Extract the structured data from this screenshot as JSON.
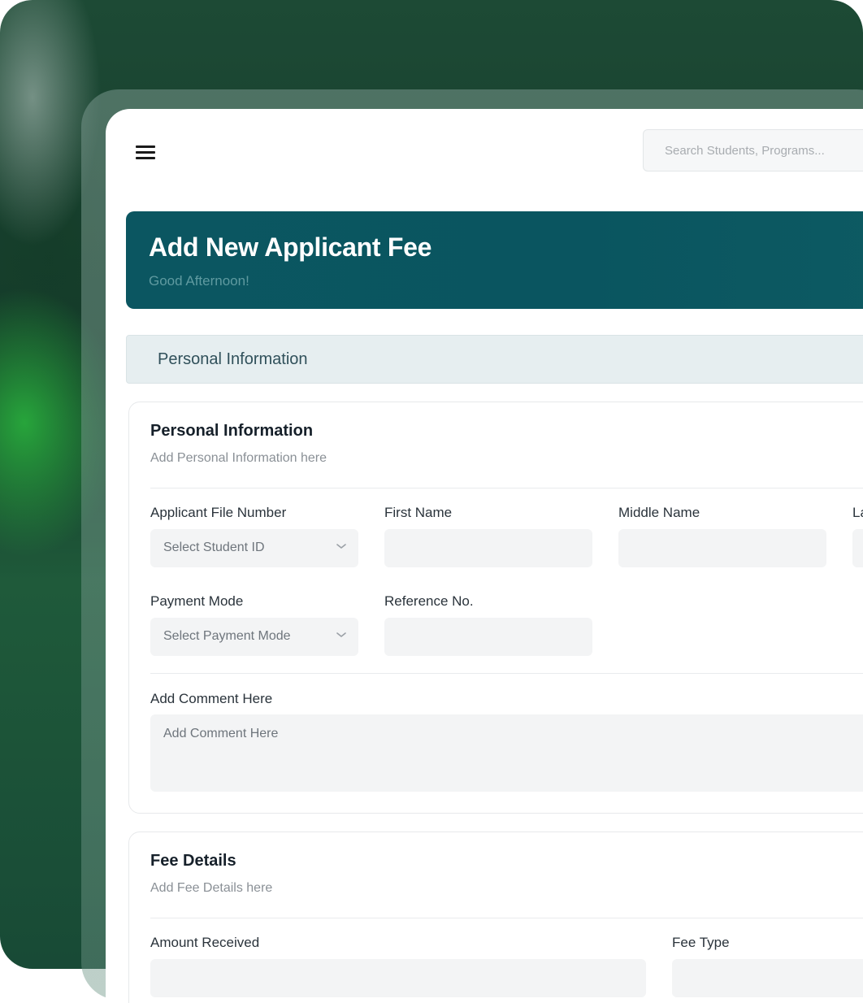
{
  "header": {
    "search_placeholder": "Search Students, Programs..."
  },
  "banner": {
    "title": "Add New Applicant Fee",
    "greeting": "Good Afternoon!"
  },
  "section_tab": {
    "label": "Personal Information"
  },
  "personal_card": {
    "title": "Personal Information",
    "subtitle": "Add Personal Information here",
    "fields": {
      "file_number_label": "Applicant File Number",
      "file_number_placeholder": "Select Student ID",
      "first_name_label": "First Name",
      "middle_name_label": "Middle Name",
      "last_name_label_partial": "La",
      "payment_mode_label": "Payment Mode",
      "payment_mode_placeholder": "Select Payment Mode",
      "reference_label": "Reference No.",
      "comment_label": "Add Comment Here",
      "comment_placeholder": "Add Comment Here"
    }
  },
  "fee_card": {
    "title": "Fee Details",
    "subtitle": "Add Fee Details here",
    "fields": {
      "amount_label": "Amount Received",
      "fee_type_label": "Fee Type"
    }
  },
  "icons": {
    "menu": "hamburger-menu-icon",
    "chevron": "chevron-down-icon"
  }
}
